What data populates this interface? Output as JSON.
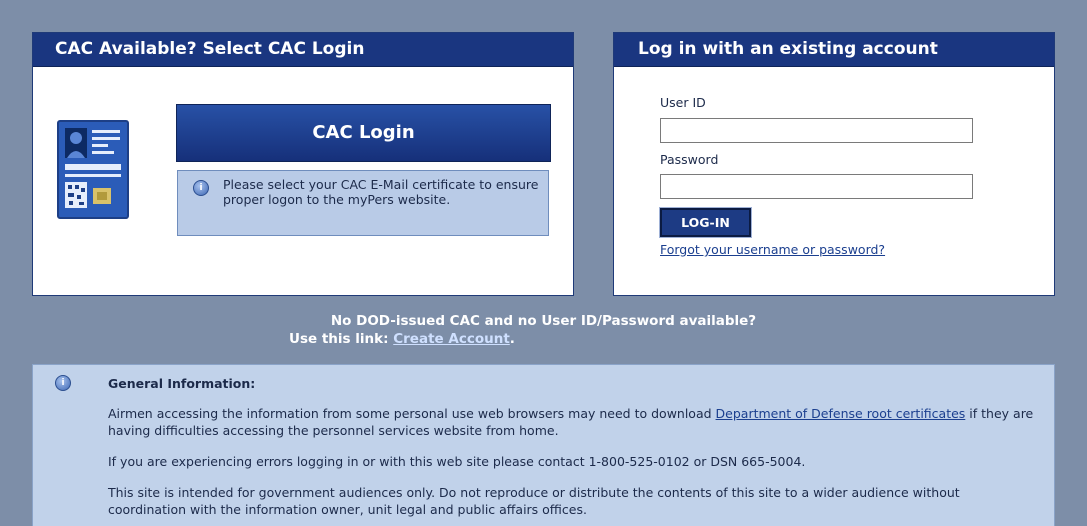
{
  "cac_panel": {
    "title": "CAC Available? Select CAC Login",
    "button_label": "CAC Login",
    "info_text": "Please select your CAC E-Mail certificate to ensure proper logon to the myPers website.",
    "card_icon": "cac-card-icon",
    "info_icon": "info-icon"
  },
  "login_panel": {
    "title": "Log in with an existing account",
    "user_id_label": "User ID",
    "user_id_value": "",
    "password_label": "Password",
    "password_value": "",
    "login_button": "LOG-IN",
    "forgot_link": "Forgot your username or password?"
  },
  "no_cac": {
    "line1": "No DOD-issued CAC and no User ID/Password available?",
    "line2_prefix": "Use this link:",
    "create_link": "Create Account",
    "line2_suffix": "."
  },
  "general_info": {
    "title": "General Information:",
    "p1_prefix": "Airmen accessing the information from some personal use web browsers may need to download",
    "p1_link": "Department of Defense root certificates",
    "p1_suffix": "if they are having difficulties accessing the personnel services website from home.",
    "p2": "If you are experiencing errors logging in or with this web site please contact 1-800-525-0102 or DSN 665-5004.",
    "p3": "This site is intended for government audiences only. Do not reproduce or distribute the contents of this site to a wider audience without coordination with the information owner, unit legal and public affairs offices."
  },
  "colors": {
    "background": "#7d8ea8",
    "header": "#1a3680",
    "info_box": "#b9cbe7",
    "link": "#1b3f8f"
  }
}
